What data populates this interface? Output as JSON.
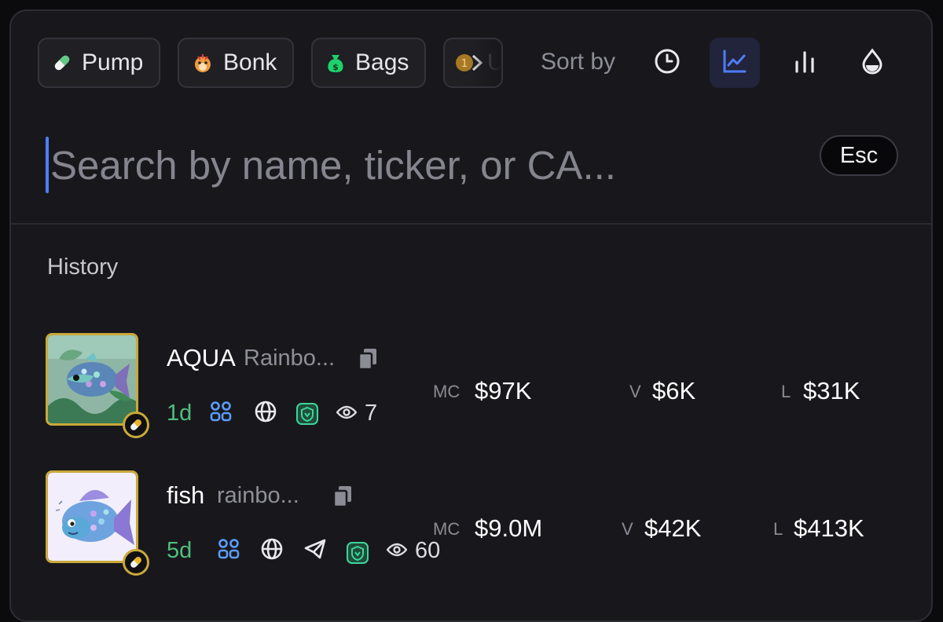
{
  "toolbar": {
    "launchpads": [
      {
        "label": "Pump",
        "icon": "pill-icon"
      },
      {
        "label": "Bonk",
        "icon": "bonk-dog-icon"
      },
      {
        "label": "Bags",
        "icon": "money-bag-icon"
      },
      {
        "label": "U",
        "icon": "coin-one-icon"
      }
    ],
    "sort_by_label": "Sort by",
    "sort_options": [
      {
        "icon": "clock-icon",
        "active": false
      },
      {
        "icon": "trend-line-icon",
        "active": true
      },
      {
        "icon": "bar-chart-icon",
        "active": false
      },
      {
        "icon": "droplet-icon",
        "active": false
      }
    ],
    "active_color": "#4f7dff"
  },
  "search": {
    "placeholder": "Search by name, ticker, or CA...",
    "value": "",
    "esc_label": "Esc"
  },
  "history": {
    "label": "History",
    "tokens": [
      {
        "ticker": "AQUA",
        "name": "Rainbo...",
        "age": "1d",
        "links": [
          "community-icon",
          "globe-icon",
          "shield-logo-icon"
        ],
        "views": "7",
        "mc_label": "MC",
        "mc": "$97K",
        "v_label": "V",
        "v": "$6K",
        "l_label": "L",
        "l": "$31K"
      },
      {
        "ticker": "fish",
        "name": "rainbo...",
        "age": "5d",
        "links": [
          "community-icon",
          "globe-icon",
          "telegram-icon",
          "shield-logo-icon"
        ],
        "views": "60",
        "mc_label": "MC",
        "mc": "$9.0M",
        "v_label": "V",
        "v": "$42K",
        "l_label": "L",
        "l": "$413K"
      }
    ]
  },
  "colors": {
    "age_green": "#4fbf7d",
    "badge_gold": "#c9a93a",
    "community_blue": "#5b9dff"
  }
}
